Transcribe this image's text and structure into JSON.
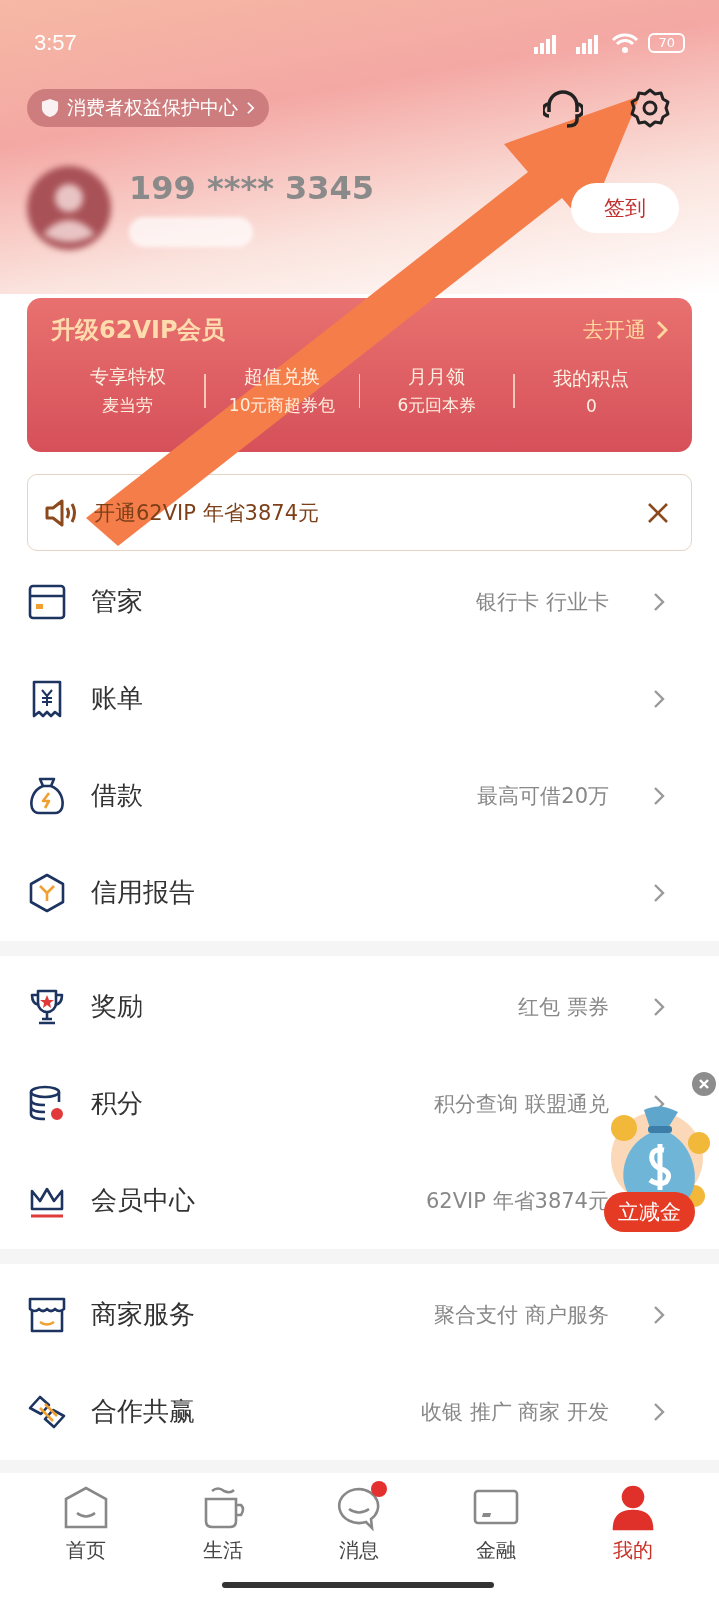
{
  "status_bar": {
    "time": "3:57",
    "battery": "70"
  },
  "header": {
    "protection_link": "消费者权益保护中心",
    "user_name": "199 **** 3345",
    "sign_in_button": "签到"
  },
  "vip_card": {
    "title": "升级62VIP会员",
    "action": "去开通",
    "benefits": [
      {
        "title": "专享特权",
        "subtitle": "麦当劳"
      },
      {
        "title": "超值兑换",
        "subtitle": "10元商超券包"
      },
      {
        "title": "月月领",
        "subtitle": "6元回本券"
      },
      {
        "title": "我的积点",
        "subtitle": "0"
      }
    ]
  },
  "notice": {
    "text": "开通62VIP 年省3874元"
  },
  "sections": [
    {
      "items": [
        {
          "label": "管家",
          "detail": "银行卡 行业卡"
        },
        {
          "label": "账单"
        },
        {
          "label": "借款",
          "detail": "最高可借20万"
        },
        {
          "label": "信用报告"
        }
      ]
    },
    {
      "items": [
        {
          "label": "奖励",
          "detail": "红包 票券"
        },
        {
          "label": "积分",
          "detail": "积分查询 联盟通兑"
        },
        {
          "label": "会员中心",
          "detail": "62VIP 年省3874元"
        }
      ]
    },
    {
      "items": [
        {
          "label": "商家服务",
          "detail": "聚合支付 商户服务"
        },
        {
          "label": "合作共赢",
          "detail": "收银 推广 商家 开发"
        }
      ]
    }
  ],
  "floating_ad": {
    "label": "立减金"
  },
  "tabs": [
    {
      "label": "首页",
      "selected": false,
      "badge": false
    },
    {
      "label": "生活",
      "selected": false,
      "badge": false
    },
    {
      "label": "消息",
      "selected": false,
      "badge": true
    },
    {
      "label": "金融",
      "selected": false,
      "badge": false
    },
    {
      "label": "我的",
      "selected": true,
      "badge": false
    }
  ]
}
